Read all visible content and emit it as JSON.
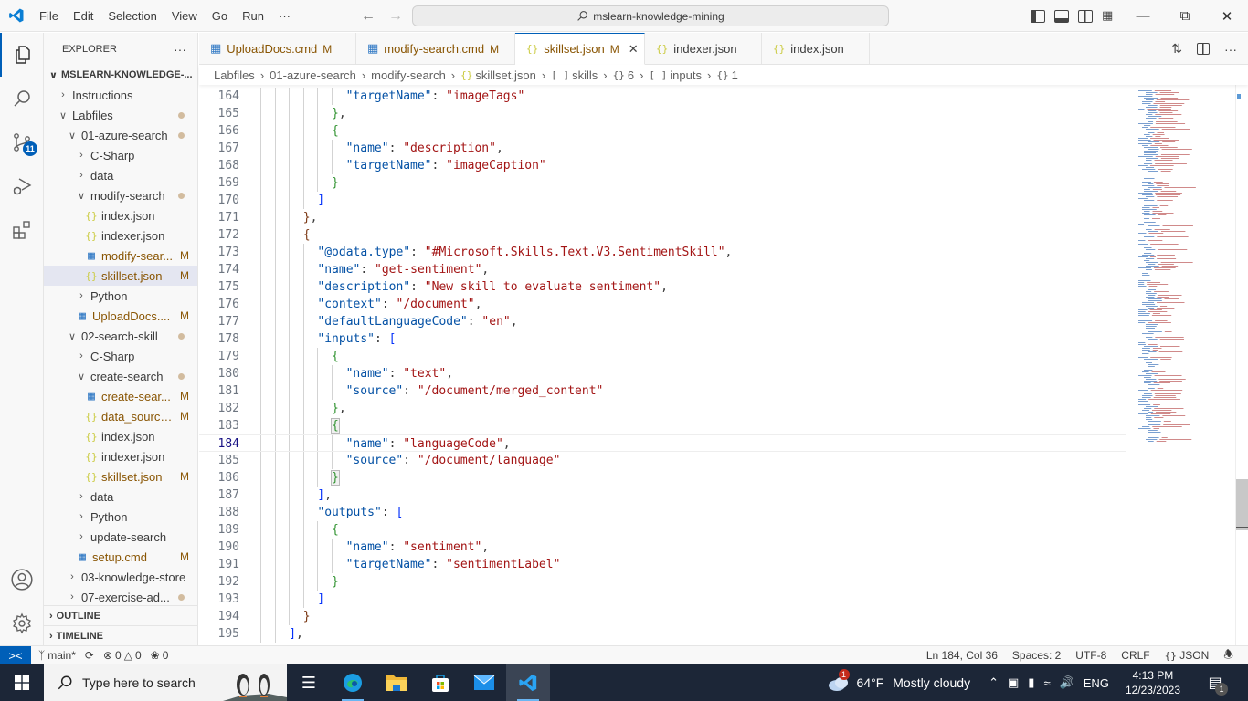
{
  "titlebar": {
    "menu": [
      "File",
      "Edit",
      "Selection",
      "View",
      "Go",
      "Run",
      "···"
    ],
    "command_center": "mslearn-knowledge-mining",
    "layout_icons": [
      "toggle-primary-sidebar",
      "toggle-panel",
      "toggle-secondary-sidebar",
      "customize-layout"
    ],
    "window_controls": {
      "minimize": "—",
      "restore": "⧉",
      "close": "✕"
    }
  },
  "activity_bar": {
    "items": [
      {
        "name": "explorer",
        "active": true
      },
      {
        "name": "search"
      },
      {
        "name": "source-control",
        "badge": "11"
      },
      {
        "name": "run-and-debug"
      },
      {
        "name": "extensions"
      }
    ],
    "bottom": [
      "accounts",
      "manage"
    ]
  },
  "sidebar": {
    "title": "EXPLORER",
    "more": "···",
    "root": "MSLEARN-KNOWLEDGE-...",
    "tree": [
      {
        "label": "Instructions",
        "depth": 1,
        "type": "folder",
        "open": false
      },
      {
        "label": "Labfiles",
        "depth": 1,
        "type": "folder",
        "open": true,
        "dot": true
      },
      {
        "label": "01-azure-search",
        "depth": 2,
        "type": "folder",
        "open": true,
        "dot": true
      },
      {
        "label": "C-Sharp",
        "depth": 3,
        "type": "folder",
        "open": false
      },
      {
        "label": "data",
        "depth": 3,
        "type": "folder",
        "open": false
      },
      {
        "label": "modify-search",
        "depth": 3,
        "type": "folder",
        "open": true,
        "dot": true
      },
      {
        "label": "index.json",
        "depth": 4,
        "type": "json"
      },
      {
        "label": "indexer.json",
        "depth": 4,
        "type": "json"
      },
      {
        "label": "modify-sear...",
        "depth": 4,
        "type": "cmd",
        "status": "M"
      },
      {
        "label": "skillset.json",
        "depth": 4,
        "type": "json",
        "status": "M",
        "selected": true
      },
      {
        "label": "Python",
        "depth": 3,
        "type": "folder",
        "open": false
      },
      {
        "label": "UploadDocs....",
        "depth": 3,
        "type": "cmd",
        "status": "M"
      },
      {
        "label": "02-search-skill",
        "depth": 2,
        "type": "folder",
        "open": true,
        "dot": true
      },
      {
        "label": "C-Sharp",
        "depth": 3,
        "type": "folder",
        "open": false
      },
      {
        "label": "create-search",
        "depth": 3,
        "type": "folder",
        "open": true,
        "dot": true
      },
      {
        "label": "create-sear...",
        "depth": 4,
        "type": "cmd",
        "status": "M"
      },
      {
        "label": "data_source...",
        "depth": 4,
        "type": "json",
        "status": "M"
      },
      {
        "label": "index.json",
        "depth": 4,
        "type": "json"
      },
      {
        "label": "indexer.json",
        "depth": 4,
        "type": "json"
      },
      {
        "label": "skillset.json",
        "depth": 4,
        "type": "json",
        "status": "M"
      },
      {
        "label": "data",
        "depth": 3,
        "type": "folder",
        "open": false
      },
      {
        "label": "Python",
        "depth": 3,
        "type": "folder",
        "open": false
      },
      {
        "label": "update-search",
        "depth": 3,
        "type": "folder",
        "open": false
      },
      {
        "label": "setup.cmd",
        "depth": 3,
        "type": "cmd",
        "status": "M"
      },
      {
        "label": "03-knowledge-store",
        "depth": 2,
        "type": "folder",
        "open": false
      },
      {
        "label": "07-exercise-ad...",
        "depth": 2,
        "type": "folder",
        "open": false,
        "dot": true
      }
    ],
    "sections": [
      "OUTLINE",
      "TIMELINE"
    ]
  },
  "tabs": [
    {
      "label": "UploadDocs.cmd",
      "icon": "cmd",
      "status": "M"
    },
    {
      "label": "modify-search.cmd",
      "icon": "cmd",
      "status": "M"
    },
    {
      "label": "skillset.json",
      "icon": "json",
      "status": "M",
      "active": true,
      "close": "✕"
    },
    {
      "label": "indexer.json",
      "icon": "json"
    },
    {
      "label": "index.json",
      "icon": "json"
    }
  ],
  "breadcrumb": [
    {
      "label": "Labfiles"
    },
    {
      "label": "01-azure-search"
    },
    {
      "label": "modify-search"
    },
    {
      "label": "skillset.json",
      "icon": "{}"
    },
    {
      "label": "skills",
      "icon": "[ ]"
    },
    {
      "label": "6",
      "icon": "{}"
    },
    {
      "label": "inputs",
      "icon": "[ ]"
    },
    {
      "label": "1",
      "icon": "{}"
    }
  ],
  "editor": {
    "current_line": 184,
    "lines": [
      {
        "n": 164,
        "indent": 12,
        "tokens": [
          [
            "k",
            "\"targetName\""
          ],
          [
            "p",
            ": "
          ],
          [
            "s",
            "\"imageTags\""
          ]
        ]
      },
      {
        "n": 165,
        "indent": 10,
        "tokens": [
          [
            "b1",
            "}"
          ],
          [
            "p",
            ","
          ]
        ]
      },
      {
        "n": 166,
        "indent": 10,
        "tokens": [
          [
            "b1",
            "{"
          ]
        ]
      },
      {
        "n": 167,
        "indent": 12,
        "tokens": [
          [
            "k",
            "\"name\""
          ],
          [
            "p",
            ": "
          ],
          [
            "s",
            "\"description\""
          ],
          [
            "p",
            ","
          ]
        ]
      },
      {
        "n": 168,
        "indent": 12,
        "tokens": [
          [
            "k",
            "\"targetName\""
          ],
          [
            "p",
            ": "
          ],
          [
            "s",
            "\"imageCaption\""
          ]
        ]
      },
      {
        "n": 169,
        "indent": 10,
        "tokens": [
          [
            "b1",
            "}"
          ]
        ]
      },
      {
        "n": 170,
        "indent": 8,
        "tokens": [
          [
            "b3",
            "]"
          ]
        ]
      },
      {
        "n": 171,
        "indent": 6,
        "tokens": [
          [
            "b2",
            "}"
          ],
          [
            "p",
            ","
          ]
        ]
      },
      {
        "n": 172,
        "indent": 6,
        "tokens": [
          [
            "b2",
            "{"
          ]
        ]
      },
      {
        "n": 173,
        "indent": 8,
        "tokens": [
          [
            "k",
            "\"@odata.type\""
          ],
          [
            "p",
            ": "
          ],
          [
            "s",
            "\"#Microsoft.Skills.Text.V3.SentimentSkill\""
          ],
          [
            "p",
            ","
          ]
        ]
      },
      {
        "n": 174,
        "indent": 8,
        "tokens": [
          [
            "k",
            "\"name\""
          ],
          [
            "p",
            ": "
          ],
          [
            "s",
            "\"get-sentiment\""
          ],
          [
            "p",
            ","
          ]
        ]
      },
      {
        "n": 175,
        "indent": 8,
        "tokens": [
          [
            "k",
            "\"description\""
          ],
          [
            "p",
            ": "
          ],
          [
            "s",
            "\"New skill to evaluate sentiment\""
          ],
          [
            "p",
            ","
          ]
        ]
      },
      {
        "n": 176,
        "indent": 8,
        "tokens": [
          [
            "k",
            "\"context\""
          ],
          [
            "p",
            ": "
          ],
          [
            "s",
            "\"/document\""
          ],
          [
            "p",
            ","
          ]
        ]
      },
      {
        "n": 177,
        "indent": 8,
        "tokens": [
          [
            "k",
            "\"defaultLanguageCode\""
          ],
          [
            "p",
            ": "
          ],
          [
            "s",
            "\"en\""
          ],
          [
            "p",
            ","
          ]
        ]
      },
      {
        "n": 178,
        "indent": 8,
        "tokens": [
          [
            "k",
            "\"inputs\""
          ],
          [
            "p",
            ": "
          ],
          [
            "b3",
            "["
          ]
        ]
      },
      {
        "n": 179,
        "indent": 10,
        "tokens": [
          [
            "b1",
            "{"
          ]
        ]
      },
      {
        "n": 180,
        "indent": 12,
        "tokens": [
          [
            "k",
            "\"name\""
          ],
          [
            "p",
            ": "
          ],
          [
            "s",
            "\"text\""
          ],
          [
            "p",
            ","
          ]
        ]
      },
      {
        "n": 181,
        "indent": 12,
        "tokens": [
          [
            "k",
            "\"source\""
          ],
          [
            "p",
            ": "
          ],
          [
            "s",
            "\"/document/merged_content\""
          ]
        ]
      },
      {
        "n": 182,
        "indent": 10,
        "tokens": [
          [
            "b1",
            "}"
          ],
          [
            "p",
            ","
          ]
        ]
      },
      {
        "n": 183,
        "indent": 10,
        "tokens": [
          [
            "b1 bm",
            "{"
          ]
        ]
      },
      {
        "n": 184,
        "indent": 12,
        "tokens": [
          [
            "k",
            "\"name\""
          ],
          [
            "p",
            ": "
          ],
          [
            "s",
            "\"languageCode\""
          ],
          [
            "p",
            ","
          ]
        ]
      },
      {
        "n": 185,
        "indent": 12,
        "tokens": [
          [
            "k",
            "\"source\""
          ],
          [
            "p",
            ": "
          ],
          [
            "s",
            "\"/document/language\""
          ]
        ]
      },
      {
        "n": 186,
        "indent": 10,
        "tokens": [
          [
            "b1 bm",
            "}"
          ]
        ]
      },
      {
        "n": 187,
        "indent": 8,
        "tokens": [
          [
            "b3",
            "]"
          ],
          [
            "p",
            ","
          ]
        ]
      },
      {
        "n": 188,
        "indent": 8,
        "tokens": [
          [
            "k",
            "\"outputs\""
          ],
          [
            "p",
            ": "
          ],
          [
            "b3",
            "["
          ]
        ]
      },
      {
        "n": 189,
        "indent": 10,
        "tokens": [
          [
            "b1",
            "{"
          ]
        ]
      },
      {
        "n": 190,
        "indent": 12,
        "tokens": [
          [
            "k",
            "\"name\""
          ],
          [
            "p",
            ": "
          ],
          [
            "s",
            "\"sentiment\""
          ],
          [
            "p",
            ","
          ]
        ]
      },
      {
        "n": 191,
        "indent": 12,
        "tokens": [
          [
            "k",
            "\"targetName\""
          ],
          [
            "p",
            ": "
          ],
          [
            "s",
            "\"sentimentLabel\""
          ]
        ]
      },
      {
        "n": 192,
        "indent": 10,
        "tokens": [
          [
            "b1",
            "}"
          ]
        ]
      },
      {
        "n": 193,
        "indent": 8,
        "tokens": [
          [
            "b3",
            "]"
          ]
        ]
      },
      {
        "n": 194,
        "indent": 6,
        "tokens": [
          [
            "b2",
            "}"
          ]
        ]
      },
      {
        "n": 195,
        "indent": 4,
        "tokens": [
          [
            "b3",
            "]"
          ],
          [
            "p",
            ","
          ]
        ]
      }
    ]
  },
  "statusbar": {
    "remote": "><",
    "branch": "main*",
    "errors": "0",
    "warnings": "0",
    "ports": "0",
    "position": "Ln 184, Col 36",
    "spaces": "Spaces: 2",
    "encoding": "UTF-8",
    "eol": "CRLF",
    "language": "JSON"
  },
  "taskbar": {
    "search_placeholder": "Type here to search",
    "apps": [
      "task-view",
      "edge",
      "file-explorer",
      "store",
      "mail",
      "vscode"
    ],
    "weather": {
      "temp": "64°F",
      "condition": "Mostly cloudy",
      "badge": "1"
    },
    "language": "ENG",
    "time": "4:13 PM",
    "date": "12/23/2023",
    "notifications": "1"
  },
  "colors": {
    "accent": "#005fb8",
    "key": "#0451a5",
    "string": "#a31515",
    "modified": "#895503",
    "taskbar": "#1c2637"
  }
}
